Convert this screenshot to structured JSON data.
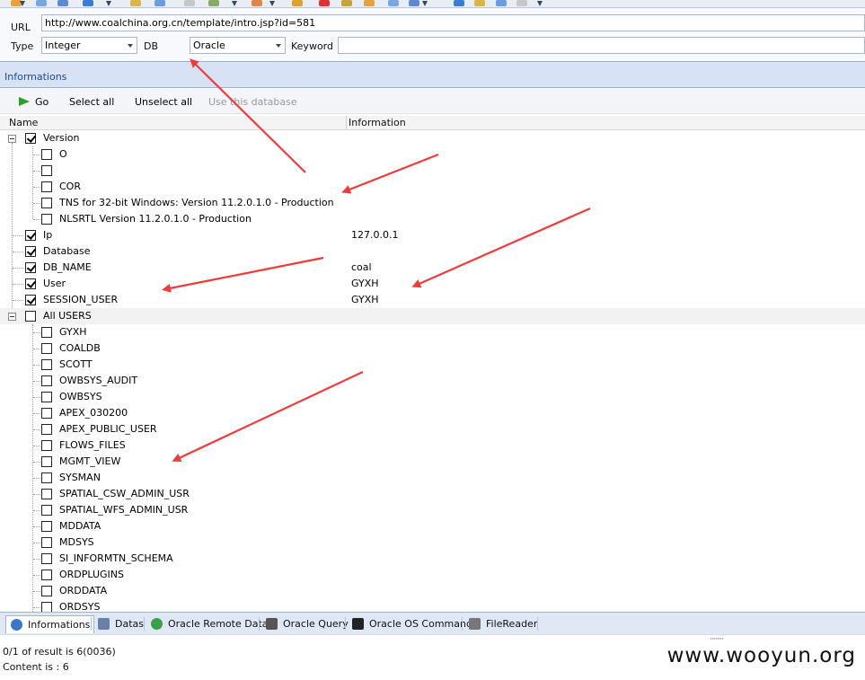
{
  "toolbar": {
    "icon_colors": [
      "#e8a23b",
      "#7aa7e0",
      "#5f8ad0",
      "#3a7bd5",
      "#d9b54a",
      "#6a9ce0",
      "#c7c7c7",
      "#8a6",
      "#d84",
      "#e0a030",
      "#d33",
      "#c9a23a"
    ]
  },
  "form": {
    "url_label": "URL",
    "url_value": "http://www.coalchina.org.cn/template/intro.jsp?id=581",
    "type_label": "Type",
    "type_value": "Integer",
    "db_label": "DB",
    "db_value": "Oracle",
    "keyword_label": "Keyword",
    "keyword_value": ""
  },
  "panel": {
    "title": "Informations"
  },
  "actions": {
    "go": "Go",
    "select_all": "Select all",
    "unselect_all": "Unselect all",
    "use_db": "Use this database"
  },
  "grid": {
    "col_name": "Name",
    "col_info": "Information"
  },
  "tree": [
    {
      "name": "Version",
      "info": "",
      "level": 0,
      "checked": true,
      "expander": true
    },
    {
      "name": "O",
      "info": "",
      "level": 1,
      "checked": false
    },
    {
      "name": "",
      "info": "",
      "level": 1,
      "checked": false
    },
    {
      "name": "COR",
      "info": "",
      "level": 1,
      "checked": false
    },
    {
      "name": "TNS for 32-bit Windows: Version 11.2.0.1.0 - Production",
      "info": "",
      "level": 1,
      "checked": false
    },
    {
      "name": "NLSRTL Version 11.2.0.1.0 - Production",
      "info": "",
      "level": 1,
      "checked": false
    },
    {
      "name": "Ip",
      "info": "127.0.0.1",
      "level": 0,
      "checked": true
    },
    {
      "name": "Database",
      "info": "",
      "level": 0,
      "checked": true
    },
    {
      "name": "DB_NAME",
      "info": "coal",
      "level": 0,
      "checked": true
    },
    {
      "name": "User",
      "info": "GYXH",
      "level": 0,
      "checked": true
    },
    {
      "name": "SESSION_USER",
      "info": "GYXH",
      "level": 0,
      "checked": true
    },
    {
      "name": "All USERS",
      "info": "",
      "level": 0,
      "checked": false,
      "expander": true,
      "highlight": true
    },
    {
      "name": "GYXH",
      "info": "",
      "level": 1,
      "checked": false
    },
    {
      "name": "COALDB",
      "info": "",
      "level": 1,
      "checked": false
    },
    {
      "name": "SCOTT",
      "info": "",
      "level": 1,
      "checked": false
    },
    {
      "name": "OWBSYS_AUDIT",
      "info": "",
      "level": 1,
      "checked": false
    },
    {
      "name": "OWBSYS",
      "info": "",
      "level": 1,
      "checked": false
    },
    {
      "name": "APEX_030200",
      "info": "",
      "level": 1,
      "checked": false
    },
    {
      "name": "APEX_PUBLIC_USER",
      "info": "",
      "level": 1,
      "checked": false
    },
    {
      "name": "FLOWS_FILES",
      "info": "",
      "level": 1,
      "checked": false
    },
    {
      "name": "MGMT_VIEW",
      "info": "",
      "level": 1,
      "checked": false
    },
    {
      "name": "SYSMAN",
      "info": "",
      "level": 1,
      "checked": false
    },
    {
      "name": "SPATIAL_CSW_ADMIN_USR",
      "info": "",
      "level": 1,
      "checked": false
    },
    {
      "name": "SPATIAL_WFS_ADMIN_USR",
      "info": "",
      "level": 1,
      "checked": false
    },
    {
      "name": "MDDATA",
      "info": "",
      "level": 1,
      "checked": false
    },
    {
      "name": "MDSYS",
      "info": "",
      "level": 1,
      "checked": false
    },
    {
      "name": "SI_INFORMTN_SCHEMA",
      "info": "",
      "level": 1,
      "checked": false
    },
    {
      "name": "ORDPLUGINS",
      "info": "",
      "level": 1,
      "checked": false
    },
    {
      "name": "ORDDATA",
      "info": "",
      "level": 1,
      "checked": false
    },
    {
      "name": "ORDSYS",
      "info": "",
      "level": 1,
      "checked": false
    }
  ],
  "tabs": [
    {
      "label": "Informations",
      "icon": "info-icon",
      "color": "#3a78c8",
      "active": true
    },
    {
      "label": "Datas",
      "icon": "database-icon",
      "color": "#6b7fa8"
    },
    {
      "label": "Oracle Remote Data",
      "icon": "globe-icon",
      "color": "#3aa04a"
    },
    {
      "label": "Oracle Query",
      "icon": "sql-icon",
      "color": "#555555"
    },
    {
      "label": "Oracle OS Command",
      "icon": "terminal-icon",
      "color": "#222222"
    },
    {
      "label": "FileReader",
      "icon": "file-icon",
      "color": "#777777"
    }
  ],
  "status": {
    "result": "0/1 of result is 6(0036)",
    "content": "Content is : 6"
  },
  "watermark": "www.wooyun.org",
  "annotation_color": "#ee3b3b"
}
